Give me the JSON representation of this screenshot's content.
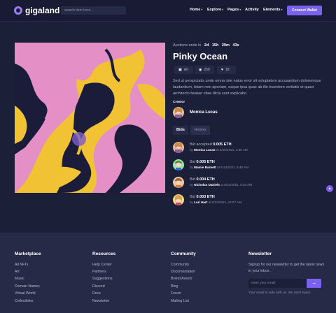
{
  "header": {
    "logo_text": "gigaland",
    "search_placeholder": "search item here...",
    "nav": [
      {
        "label": "Home",
        "has_dropdown": true
      },
      {
        "label": "Explore",
        "has_dropdown": true
      },
      {
        "label": "Pages",
        "has_dropdown": true
      },
      {
        "label": "Activity",
        "has_dropdown": false
      },
      {
        "label": "Elements",
        "has_dropdown": true
      }
    ],
    "connect_label": "Connect Wallet"
  },
  "item": {
    "auction_label": "Auctions ends in",
    "countdown": [
      "2d",
      "15h",
      "29m",
      "43s"
    ],
    "title": "Pinky Ocean",
    "stats": [
      {
        "icon": "image-icon",
        "value": "Art"
      },
      {
        "icon": "eye-icon",
        "value": "250"
      },
      {
        "icon": "heart-icon",
        "value": "18"
      }
    ],
    "description": "Sed ut perspiciatis unde omnis iste natus error sit voluptatem accusantium doloremque laudantium, totam rem aperiam, eaque ipsa quae ab illo inventore veritatis et quasi architecto beatae vitae dicta sunt explicabo.",
    "creator_label": "Creator",
    "creator_name": "Monica Lucas",
    "tabs": [
      "Bids",
      "History"
    ],
    "bids": [
      {
        "prefix": "Bid accepted",
        "amount": "0.005 ETH",
        "by": "by",
        "bidder": "Monica Lucas",
        "date": "at 6/15/2021, 3:20 AM"
      },
      {
        "prefix": "Bid",
        "amount": "0.005 ETH",
        "by": "by",
        "bidder": "Mamie Barnett",
        "date": "at 6/14/2021, 5:40 AM"
      },
      {
        "prefix": "Bid",
        "amount": "0.004 ETH",
        "by": "by",
        "bidder": "Nicholas Daniels",
        "date": "at 6/13/2021, 5:03 AM"
      },
      {
        "prefix": "Bid",
        "amount": "0.003 ETH",
        "by": "by",
        "bidder": "Lori Hart",
        "date": "at 6/12/2021, 12:57 AM"
      }
    ]
  },
  "footer": {
    "columns": [
      {
        "title": "Marketplace",
        "links": [
          "All NFTs",
          "Art",
          "Music",
          "Domain Names",
          "Virtual World",
          "Collectibles"
        ]
      },
      {
        "title": "Resources",
        "links": [
          "Help Center",
          "Partners",
          "Suggestions",
          "Discord",
          "Docs",
          "Newsletter"
        ]
      },
      {
        "title": "Community",
        "links": [
          "Community",
          "Documentation",
          "Brand Assets",
          "Blog",
          "Forum",
          "Mailing List"
        ]
      }
    ],
    "newsletter": {
      "title": "Newsletter",
      "text": "Signup for our newsletter to get the latest news in your inbox.",
      "placeholder": "enter your email",
      "note": "Your email is safe with us. We don't spam."
    }
  },
  "colors": {
    "accent": "#7b61f0",
    "background": "#1b1f38",
    "footer": "#262a47"
  }
}
